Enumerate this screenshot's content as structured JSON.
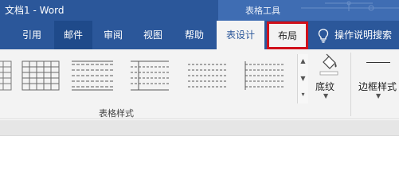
{
  "window": {
    "title": "文档1  -  Word",
    "context_title": "表格工具"
  },
  "tabs": [
    {
      "label": "引用"
    },
    {
      "label": "邮件"
    },
    {
      "label": "审阅"
    },
    {
      "label": "视图"
    },
    {
      "label": "帮助"
    },
    {
      "label": "表设计"
    },
    {
      "label": "布局"
    }
  ],
  "tell_me": {
    "label": "操作说明搜索"
  },
  "ribbon": {
    "table_styles_group_label": "表格样式",
    "shading_label": "底纹",
    "borders_label": "边框样式"
  },
  "colors": {
    "title_bar": "#2b579a",
    "context_header": "#3f6db3",
    "ribbon_bg": "#f3f3f3",
    "highlight_box": "#d0101b"
  },
  "icons": [
    "lightbulb-icon",
    "paint-bucket-icon",
    "chevron-down-icon",
    "scroll-up-icon",
    "scroll-down-icon",
    "more-icon"
  ]
}
